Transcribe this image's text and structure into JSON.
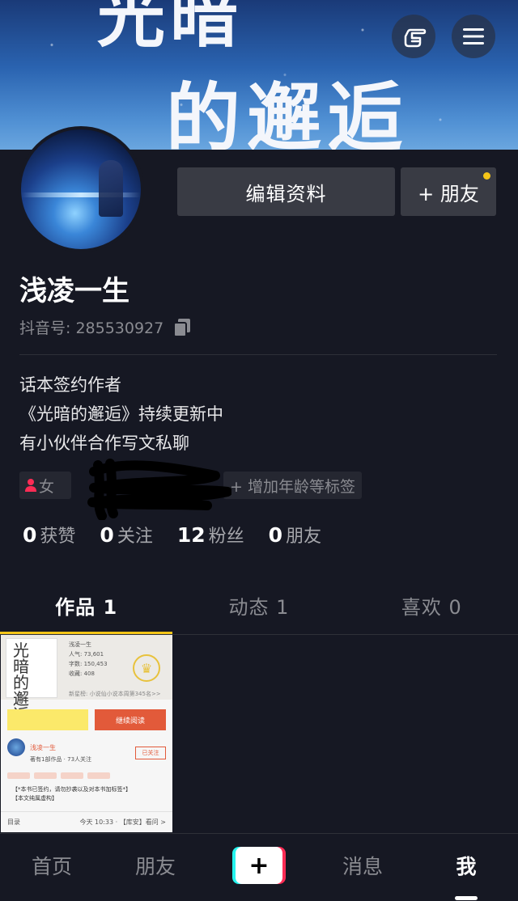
{
  "banner": {
    "line1": "光暗",
    "line2": "的邂逅"
  },
  "header_icons": {
    "left": "hand-pointer-icon",
    "right": "menu-icon"
  },
  "profile": {
    "edit_label": "编辑资料",
    "add_friend_label": "+ 朋友",
    "username": "浅凌一生",
    "douyin_id": "抖音号: 285530927",
    "bio": [
      "话本签约作者",
      "《光暗的邂逅》持续更新中",
      "有小伙伴合作写文私聊"
    ],
    "tags": {
      "gender": "女",
      "add_tag": "+ 增加年龄等标签"
    }
  },
  "stats": [
    {
      "num": "0",
      "label": "获赞"
    },
    {
      "num": "0",
      "label": "关注"
    },
    {
      "num": "12",
      "label": "粉丝"
    },
    {
      "num": "0",
      "label": "朋友"
    }
  ],
  "tabs": [
    {
      "label": "作品 1",
      "active": true
    },
    {
      "label": "动态 1",
      "active": false
    },
    {
      "label": "喜欢 0",
      "active": false
    }
  ],
  "thumbnail": {
    "cover_title": "光暗的邂逅",
    "author": "浅凌一生",
    "stats": [
      "人气: 73,601",
      "字数: 150,453",
      "收藏: 408"
    ],
    "rank": "新星榜: 小说仙小说本周第345名>>",
    "continue_read": "继续阅读",
    "follow": "已关注",
    "mini_sub": "著有1部作品 · 73人关注",
    "note": [
      "【*本书已签约，请勿抄袭以及对本书加标签*】",
      "【本文纯属虚构】"
    ],
    "footer_left": "目录",
    "footer_right": "今天 10:33 · 【库安】看问 >"
  },
  "bottom_nav": [
    {
      "label": "首页",
      "active": false
    },
    {
      "label": "朋友",
      "active": false
    },
    {
      "label": "+",
      "active": false
    },
    {
      "label": "消息",
      "active": false
    },
    {
      "label": "我",
      "active": true
    }
  ],
  "colors": {
    "accent": "#f5c518",
    "background": "#161823",
    "button": "#393b44",
    "cyan": "#25f4ee",
    "red": "#fe2c55"
  }
}
